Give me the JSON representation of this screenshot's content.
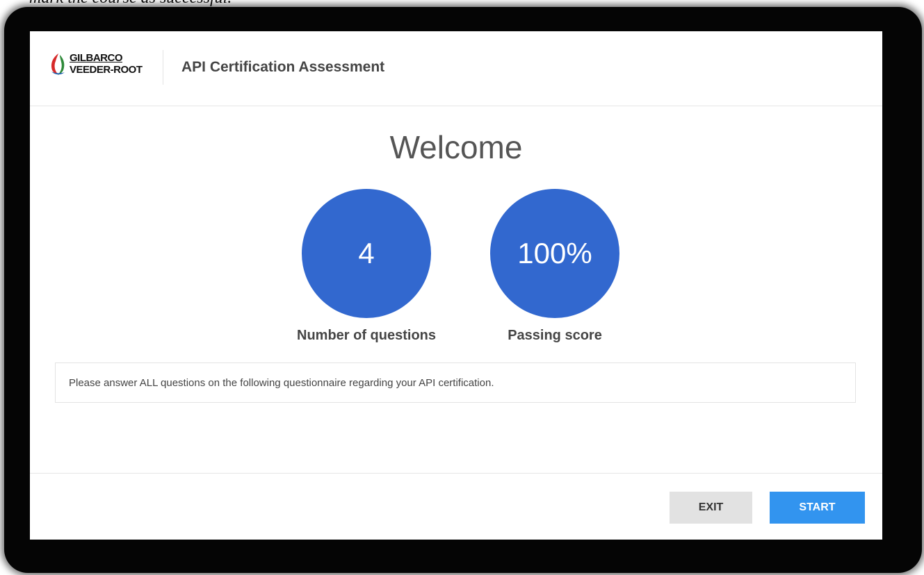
{
  "document": {
    "text_above": "mark the course as successful."
  },
  "header": {
    "logo_line1": "GILBARCO",
    "logo_line2": "VEEDER-ROOT",
    "title": "API Certification Assessment"
  },
  "main": {
    "welcome": "Welcome",
    "stats": [
      {
        "value": "4",
        "label": "Number of questions"
      },
      {
        "value": "100%",
        "label": "Passing score"
      }
    ],
    "instructions": "Please answer ALL questions on the following questionnaire regarding your API certification."
  },
  "footer": {
    "exit_label": "EXIT",
    "start_label": "START"
  },
  "colors": {
    "circle": "#3268cf",
    "start_button": "#3294ef",
    "exit_button": "#e2e2e2"
  }
}
